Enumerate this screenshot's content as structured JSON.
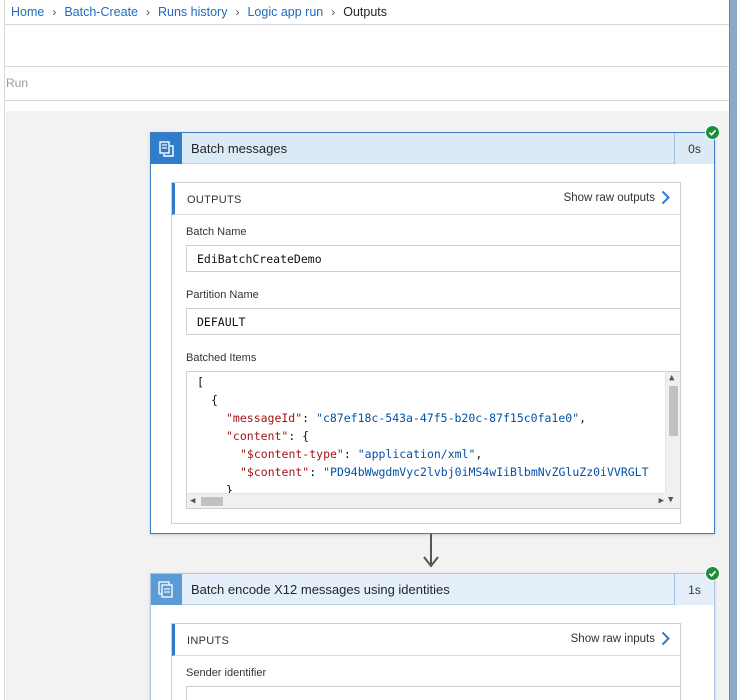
{
  "breadcrumb": {
    "items": [
      "Home",
      "Batch-Create",
      "Runs history",
      "Logic app run"
    ],
    "current": "Outputs"
  },
  "toolbar": {
    "run_label": "Run"
  },
  "batch_messages": {
    "title": "Batch messages",
    "duration": "0s",
    "status": "succeeded",
    "icon": "batch-icon",
    "outputs": {
      "title": "OUTPUTS",
      "raw_link": "Show raw outputs",
      "batch_name_label": "Batch Name",
      "batch_name_value": "EdiBatchCreateDemo",
      "partition_name_label": "Partition Name",
      "partition_name_value": "DEFAULT",
      "batched_items_label": "Batched Items",
      "code": {
        "l1": "[",
        "l2": "{",
        "l3_key": "\"messageId\"",
        "l3_val": "\"c87ef18c-543a-47f5-b20c-87f15c0fa1e0\"",
        "l4_key": "\"content\"",
        "l5_key": "\"$content-type\"",
        "l5_val": "\"application/xml\"",
        "l6_key": "\"$content\"",
        "l6_val": "\"PD94bWwgdmVyc2lvbj0iMS4wIiBlbmNvZGluZz0iVVRGLT",
        "l7": "}"
      }
    }
  },
  "batch_encode": {
    "title": "Batch encode X12 messages using identities",
    "duration": "1s",
    "status": "succeeded",
    "icon": "x12-encode-icon",
    "inputs": {
      "title": "INPUTS",
      "raw_link": "Show raw inputs",
      "sender_identifier_label": "Sender identifier"
    }
  },
  "colors": {
    "accent": "#2f7ccb",
    "header_bg": "#dceaf6",
    "success": "#1b8f3a",
    "link": "#1f6bbf"
  }
}
